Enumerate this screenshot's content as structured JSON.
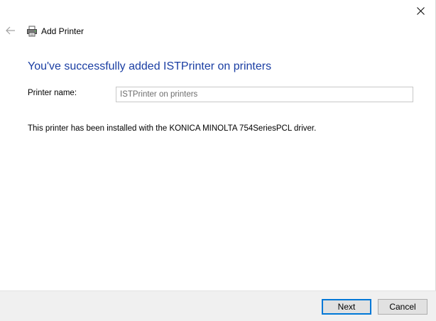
{
  "window": {
    "close_icon": "close-icon",
    "back_icon": "back-arrow-icon"
  },
  "header": {
    "icon": "printer-icon",
    "title": "Add Printer"
  },
  "main": {
    "heading": "You've successfully added ISTPrinter on printers",
    "printer_name_label": "Printer name:",
    "printer_name_value": "ISTPrinter on printers",
    "info_text": "This printer has been installed with the KONICA MINOLTA 754SeriesPCL driver."
  },
  "footer": {
    "next_label": "Next",
    "cancel_label": "Cancel"
  },
  "colors": {
    "heading": "#1a3ea3",
    "focus_border": "#0078d7",
    "footer_bg": "#f0f0f0"
  }
}
